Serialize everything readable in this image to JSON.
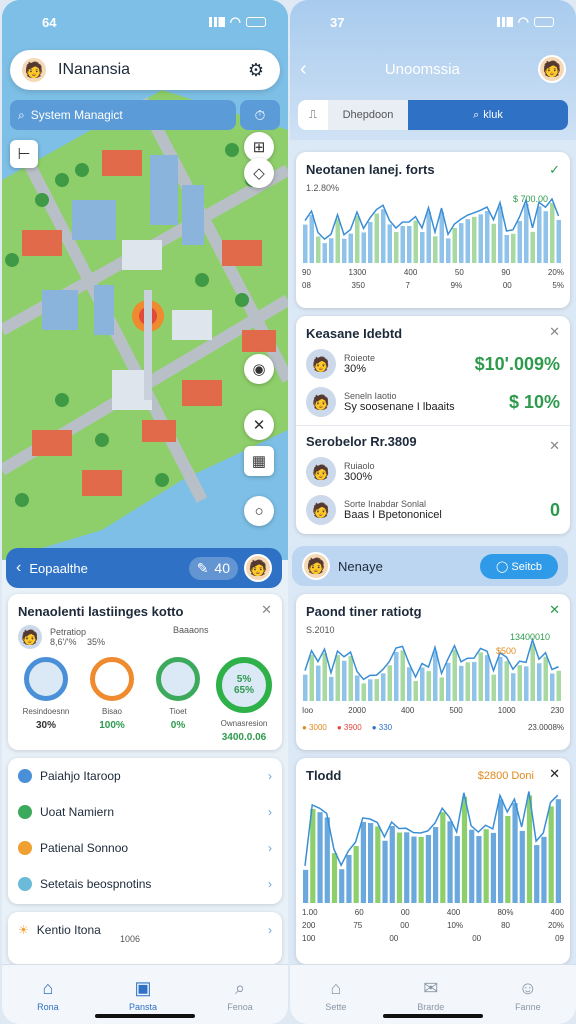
{
  "left": {
    "status": {
      "time": "64"
    },
    "header": {
      "title": "INanansia"
    },
    "search": {
      "text": "System Managict"
    },
    "panel": {
      "label": "Eopaalthe",
      "pill_value": "40"
    },
    "stats_card": {
      "title": "Nenaolenti lastiinges kotto",
      "sub_left": "Petratiop",
      "sub_left_value": "8,6'/'%",
      "sub_left_extra": "35%",
      "sub_right": "Baaaons",
      "rings": [
        {
          "label": "Resindoesnn",
          "value": "30%",
          "color": "#4a90d9"
        },
        {
          "label": "Bisao",
          "value": "100%",
          "color": "#f08a2e"
        },
        {
          "label": "Tioet",
          "value": "0%",
          "color": "#3caa5c"
        },
        {
          "label": "Ownasresion",
          "value": "3400.0.06",
          "center": "5%",
          "center2": "65%",
          "color": "#2fb14a"
        }
      ]
    },
    "menu": [
      {
        "label": "Paiahjo Itaroop",
        "color": "#4a90d9"
      },
      {
        "label": "Uoat Namiern",
        "color": "#3caa5c"
      },
      {
        "label": "Patienal Sonnoo",
        "color": "#f0a030"
      },
      {
        "label": "Setetais beospnotins",
        "color": "#6bbad8"
      }
    ],
    "bottom_card": {
      "title": "Kentio Itona",
      "value": "1006"
    },
    "tabs": [
      {
        "label": "Rona",
        "icon": "home-icon",
        "active": true
      },
      {
        "label": "Pansta",
        "icon": "store-icon",
        "active": true
      },
      {
        "label": "Fenoa",
        "icon": "search-icon",
        "active": false
      }
    ]
  },
  "right": {
    "status": {
      "time": "37"
    },
    "header": {
      "title": "Unoomssia"
    },
    "segment": {
      "left": "Dhepdoon",
      "right": "kluk"
    },
    "chart1": {
      "title": "Neotanen lanej. forts",
      "subtitle": "1.2.80%",
      "badge": "$ 700.00",
      "axis": [
        "90",
        "1300",
        "400",
        "50",
        "90",
        "20%"
      ],
      "axis2": [
        "08",
        "350",
        "7",
        "9%",
        "00",
        "5%"
      ]
    },
    "list1": {
      "title": "Keasane Idebtd",
      "rows": [
        {
          "top": "Roieote",
          "name": "30%",
          "value": "$10'.009%"
        },
        {
          "top": "Seneln Iaotio",
          "name": "Sy soosenane I lbaaits",
          "value": "$ 10%"
        }
      ]
    },
    "list2": {
      "title": "Serobelor Rr.3809",
      "rows": [
        {
          "top": "Ruiaolo",
          "name": "300%",
          "value": ""
        },
        {
          "top": "Sorte Inabdar Sonlal",
          "name": "Baas I Bpetononicel",
          "value": "0"
        }
      ]
    },
    "panel": {
      "label": "Nenaye",
      "button": "Seitcb"
    },
    "chart2": {
      "title": "Paond tiner ratiotg",
      "subtitle": "S.2010",
      "badge": "13400010",
      "badge2": "$500",
      "axis": [
        "Ioo",
        "2000",
        "400",
        "500",
        "1000",
        "230"
      ],
      "legend": [
        "3000",
        "3900",
        "330"
      ],
      "total": "23.0008%"
    },
    "chart3": {
      "title": "Tlodd",
      "badge": "$2800 Doni",
      "axis": [
        "1.00",
        "60",
        "00",
        "400",
        "80%",
        "400"
      ],
      "axis2": [
        "200",
        "75",
        "00",
        "10%",
        "80",
        "20%"
      ],
      "axis3": [
        "100",
        "00",
        "00",
        "09"
      ]
    },
    "tabs": [
      {
        "label": "Sette",
        "icon": "home-icon",
        "active": false
      },
      {
        "label": "Brarde",
        "icon": "chat-icon",
        "active": false
      },
      {
        "label": "Fanne",
        "icon": "profile-icon",
        "active": false
      }
    ]
  }
}
